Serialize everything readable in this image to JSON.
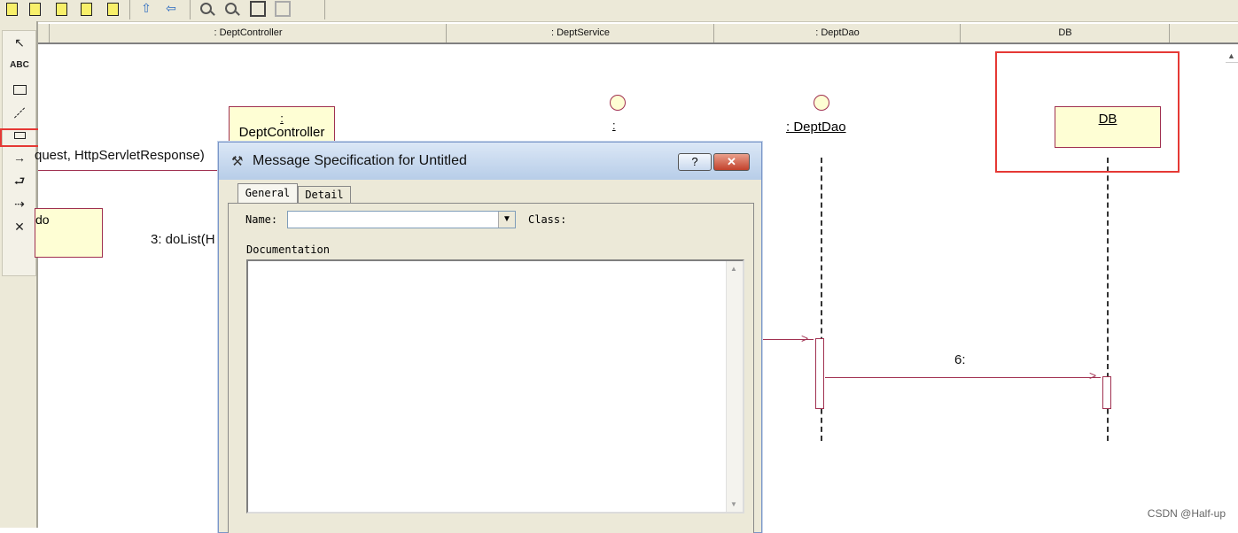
{
  "columns": [
    ": DeptController",
    ": DeptService",
    ": DeptDao",
    "DB"
  ],
  "diagram": {
    "dept_controller_colon": ":",
    "dept_controller_name": "DeptController",
    "dept_service_colon": ":",
    "dept_dao_label": ": DeptDao",
    "db_label": "DB",
    "note_text": "do",
    "msg_request": "quest, HttpServletResponse)",
    "msg_dolist": "3: doList(H",
    "msg_six": "6:"
  },
  "dialog": {
    "title": "Message Specification for Untitled",
    "help_button": "?",
    "tabs": [
      "General",
      "Detail"
    ],
    "name_label": "Name:",
    "name_value": "",
    "class_label": "Class:",
    "documentation_label": "Documentation",
    "documentation_value": ""
  },
  "colors": {
    "highlight": "#e53935",
    "message_line": "#a03050",
    "object_fill": "#fefed4"
  },
  "watermark": "CSDN @Half-up"
}
